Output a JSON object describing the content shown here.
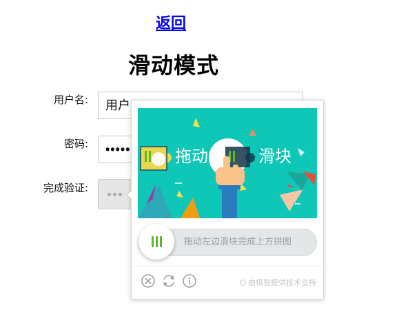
{
  "nav": {
    "back_label": "返回"
  },
  "page": {
    "title": "滑动模式"
  },
  "form": {
    "username_label": "用户名:",
    "username_value": "用户",
    "password_label": "密码:",
    "password_value": "••••••",
    "verify_label": "完成验证:"
  },
  "captcha": {
    "image_text": "拖动 滑块",
    "slider_tip": "拖动左边滑块完成上方拼图",
    "brand": "由极验提供技术支持",
    "footer_icons": [
      "close-icon",
      "refresh-icon",
      "info-icon"
    ],
    "accent_color": "#5cb82a",
    "background_color": "#0fc7b7"
  }
}
